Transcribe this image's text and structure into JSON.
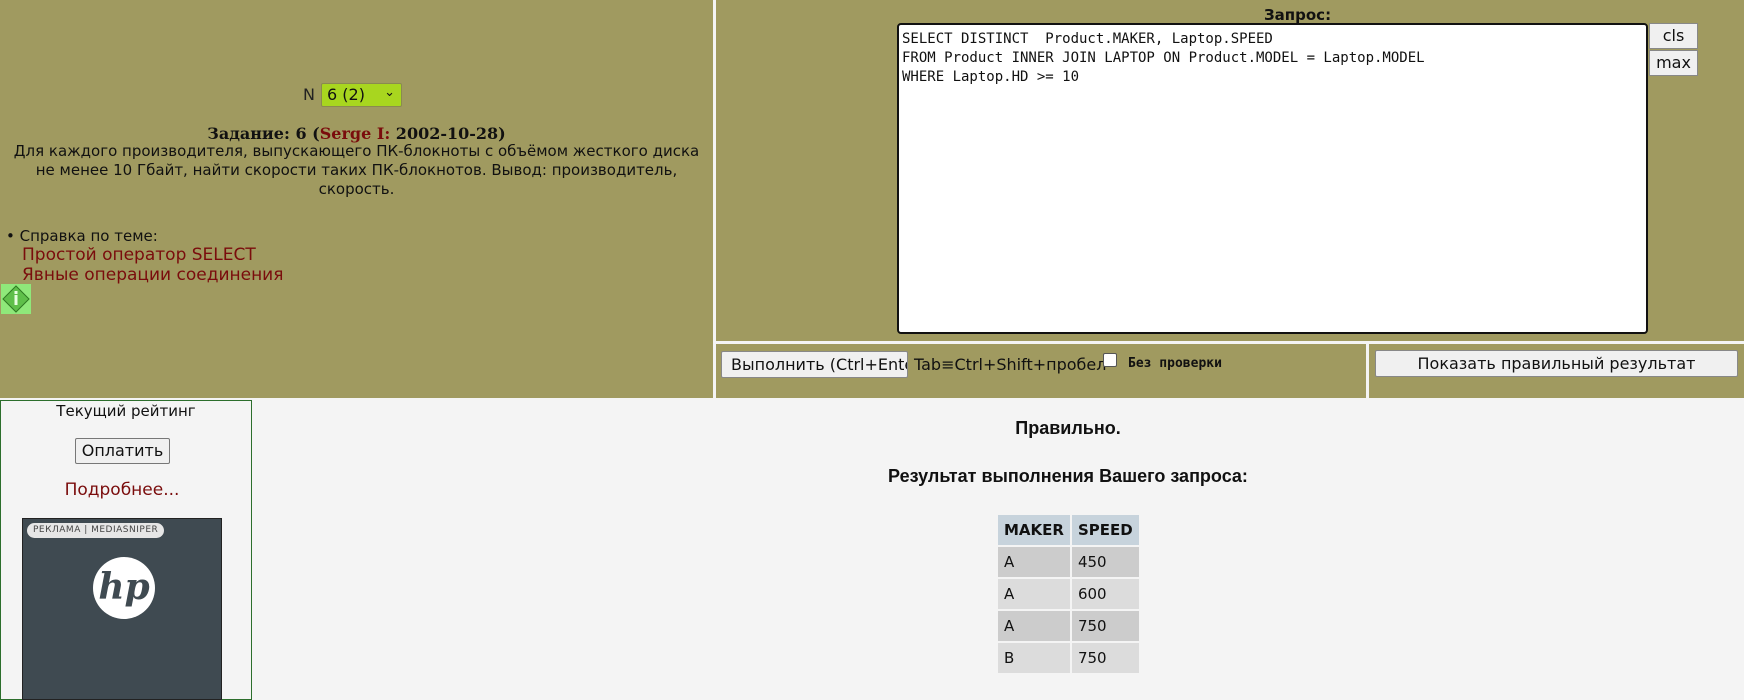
{
  "task": {
    "n_label": "N",
    "selector_value": "6 (2)",
    "heading_prefix": "Задание: 6 (",
    "author": "Serge I:",
    "heading_suffix": " 2002-10-28)",
    "description": "Для каждого производителя, выпускающего ПК-блокноты с объёмом жесткого диска не менее 10 Гбайт, найти скорости таких ПК-блокнотов. Вывод: производитель, скорость.",
    "help_label": "• Справка по теме:",
    "help_links": [
      "Простой оператор SELECT",
      "Явные операции соединения"
    ]
  },
  "query": {
    "label": "Запрос:",
    "sql": "SELECT DISTINCT  Product.MAKER, Laptop.SPEED\nFROM Product INNER JOIN LAPTOP ON Product.MODEL = Laptop.MODEL\nWHERE Laptop.HD >= 10",
    "cls_label": "cls",
    "max_label": "max"
  },
  "controls": {
    "run_label": "Выполнить (Ctrl+Enter)",
    "hotkey_text": "Tab≡Ctrl+Shift+пробел",
    "no_check_label": "Без проверки",
    "no_check_checked": false,
    "show_result_label": "Показать правильный результат"
  },
  "sidebar": {
    "rating_title": "Текущий рейтинг",
    "pay_label": "Оплатить",
    "more_link": "Подробнее...",
    "ad_label": "РЕКЛАМА | MEDIASNIPER",
    "ad_logo": "hp"
  },
  "result": {
    "status": "Правильно.",
    "heading": "Результат выполнения Вашего запроса:",
    "columns": [
      "MAKER",
      "SPEED"
    ],
    "rows": [
      [
        "A",
        "450"
      ],
      [
        "A",
        "600"
      ],
      [
        "A",
        "750"
      ],
      [
        "B",
        "750"
      ]
    ]
  },
  "colors": {
    "panel": "#a09a60",
    "link": "#7a0c0c",
    "selector": "#a8d61f",
    "sidebar_border": "#2c6e2c"
  }
}
